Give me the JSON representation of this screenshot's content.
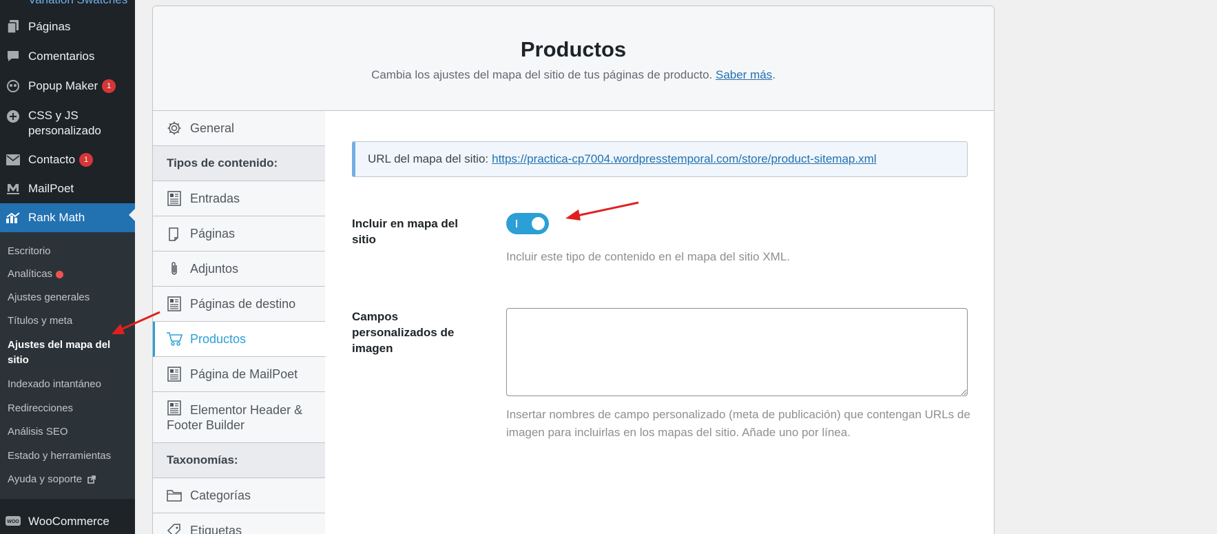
{
  "sidebar": {
    "items": [
      {
        "label": "Variation Swatches",
        "icon": "none"
      },
      {
        "label": "Páginas",
        "icon": "pages-icon"
      },
      {
        "label": "Comentarios",
        "icon": "comment-icon"
      },
      {
        "label": "Popup Maker",
        "badge": "1",
        "icon": "popup-icon"
      },
      {
        "label_line1": "CSS y JS",
        "label_line2": "personalizado",
        "icon": "plus-circle-icon"
      },
      {
        "label": "Contacto",
        "badge": "1",
        "icon": "mail-icon"
      },
      {
        "label": "MailPoet",
        "icon": "mailpoet-icon"
      },
      {
        "label": "Rank Math",
        "icon": "rankmath-icon"
      },
      {
        "label": "WooCommerce",
        "icon": "woo-icon"
      }
    ],
    "submenu": [
      {
        "label": "Escritorio"
      },
      {
        "label": "Analíticas"
      },
      {
        "label": "Ajustes generales"
      },
      {
        "label": "Títulos y meta"
      },
      {
        "label_line1": "Ajustes del mapa del",
        "label_line2": "sitio"
      },
      {
        "label": "Indexado intantáneo"
      },
      {
        "label": "Redirecciones"
      },
      {
        "label": "Análisis SEO"
      },
      {
        "label": "Estado y herramientas"
      },
      {
        "label": "Ayuda y soporte"
      }
    ]
  },
  "panel": {
    "title": "Productos",
    "description": "Cambia los ajustes del mapa del sitio de tus páginas de producto.",
    "learn_more": "Saber más",
    "tabs": [
      {
        "label": "General",
        "icon": "gear-icon"
      },
      {
        "label": "Tipos de contenido:",
        "section": true
      },
      {
        "label": "Entradas",
        "icon": "document-icon"
      },
      {
        "label": "Páginas",
        "icon": "page-icon"
      },
      {
        "label": "Adjuntos",
        "icon": "paperclip-icon"
      },
      {
        "label": "Páginas de destino",
        "icon": "document-icon"
      },
      {
        "label": "Productos",
        "icon": "cart-icon",
        "active": true
      },
      {
        "label": "Página de MailPoet",
        "icon": "document-icon"
      },
      {
        "label_line1": "Elementor Header &",
        "label_line2": "Footer Builder",
        "icon": "document-icon"
      },
      {
        "label": "Taxonomías:",
        "section": true
      },
      {
        "label": "Categorías",
        "icon": "folder-icon"
      },
      {
        "label": "Etiquetas",
        "icon": "tag-icon"
      }
    ],
    "sitemap_url_label": "URL del mapa del sitio:",
    "sitemap_url": "https://practica-cp7004.wordpresstemporal.com/store/product-sitemap.xml",
    "include_label": "Incluir en mapa del sitio",
    "include_on": true,
    "include_help": "Incluir este tipo de contenido en el mapa del sitio XML.",
    "image_fields_label": "Campos personalizados de imagen",
    "image_fields_value": "",
    "image_fields_help": "Insertar nombres de campo personalizado (meta de publicación) que contengan URLs de imagen para incluirlas en los mapas del sitio. Añade uno por línea."
  },
  "colors": {
    "accent": "#2b9fd6",
    "wp_blue": "#2271b1",
    "sidebar_bg": "#1d2327",
    "badge_red": "#d63638",
    "annotation_arrow": "#e02020"
  }
}
